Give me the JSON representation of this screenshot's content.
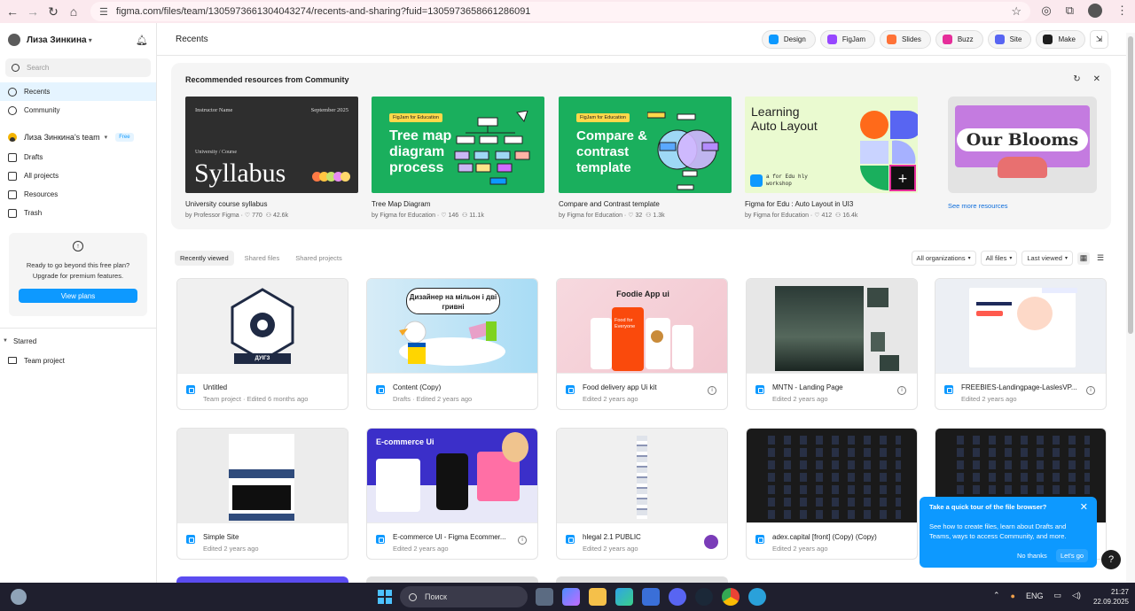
{
  "browser": {
    "url": "figma.com/files/team/1305973661304043274/recents-and-sharing?fuid=1305973658661286091"
  },
  "sidebar": {
    "user_name": "Лиза Зинкина",
    "search_placeholder": "Search",
    "nav": [
      {
        "label": "Recents",
        "icon": "clock-icon"
      },
      {
        "label": "Community",
        "icon": "globe-icon"
      }
    ],
    "team_name": "Лиза Зинкина's team",
    "team_badge": "Free",
    "team_nav": [
      {
        "label": "Drafts",
        "icon": "file-icon"
      },
      {
        "label": "All projects",
        "icon": "grid-icon"
      },
      {
        "label": "Resources",
        "icon": "resources-icon"
      },
      {
        "label": "Trash",
        "icon": "trash-icon"
      }
    ],
    "upgrade_text_1": "Ready to go beyond this free plan?",
    "upgrade_text_2": "Upgrade for premium features.",
    "upgrade_button": "View plans",
    "starred_label": "Starred",
    "starred_items": [
      "Team project"
    ]
  },
  "header": {
    "title": "Recents",
    "products": [
      {
        "label": "Design",
        "color": "#0d99ff"
      },
      {
        "label": "FigJam",
        "color": "#9747ff"
      },
      {
        "label": "Slides",
        "color": "#ff7237"
      },
      {
        "label": "Buzz",
        "color": "#e62e9a"
      },
      {
        "label": "Site",
        "color": "#5865f2"
      },
      {
        "label": "Make",
        "color": "#1e1e1e"
      }
    ]
  },
  "community": {
    "title": "Recommended resources from Community",
    "see_more": "See more resources",
    "cards": [
      {
        "title": "University course syllabus",
        "author": "by Professor Figma",
        "likes": "770",
        "users": "42.6k",
        "thumb": {
          "top_left": "Instructor Name",
          "top_right": "September 2025",
          "sub": "University / Course",
          "big": "Syllabus"
        }
      },
      {
        "title": "Tree Map Diagram",
        "author": "by Figma for Education",
        "likes": "146",
        "users": "11.1k",
        "thumb": {
          "tag": "FigJam for Education",
          "text": "Tree map diagram process"
        }
      },
      {
        "title": "Compare and Contrast template",
        "author": "by Figma for Education",
        "likes": "32",
        "users": "1.3k",
        "thumb": {
          "tag": "FigJam for Education",
          "text": "Compare & contrast template"
        }
      },
      {
        "title": "Figma for Edu : Auto Layout in UI3",
        "author": "by Figma for Education",
        "likes": "412",
        "users": "16.4k",
        "thumb": {
          "text": "Learning Auto Layout",
          "sub": "a for Edu hly workshop"
        }
      }
    ],
    "extra_thumb_text": "Our Blooms"
  },
  "tabs": [
    {
      "label": "Recently viewed",
      "active": true
    },
    {
      "label": "Shared files",
      "active": false
    },
    {
      "label": "Shared projects",
      "active": false
    }
  ],
  "filters": [
    "All organizations",
    "All files",
    "Last viewed"
  ],
  "files": [
    {
      "name": "Untitled",
      "meta": "Team project · Edited 6 months ago",
      "thumb_text": "ДУІГЗ"
    },
    {
      "name": "Content (Copy)",
      "meta": "Drafts · Edited 2 years ago",
      "thumb_text": "Дизайнер на мільон і дві гривні"
    },
    {
      "name": "Food delivery app Ui kit",
      "meta": "Edited 2 years ago",
      "thumb_text": "Foodie App ui",
      "thumb_sub": "Food for Everyone"
    },
    {
      "name": "MNTN - Landing Page",
      "meta": "Edited 2 years ago"
    },
    {
      "name": "FREEBIES-Landingpage-LaslesVP...",
      "meta": "Edited 2 years ago"
    },
    {
      "name": "Simple Site",
      "meta": "Edited 2 years ago"
    },
    {
      "name": "E-commerce UI - Figma Ecommer...",
      "meta": "Edited 2 years ago",
      "thumb_text": "E-commerce Ui"
    },
    {
      "name": "hlegal 2.1 PUBLIC",
      "meta": "Edited 2 years ago"
    },
    {
      "name": "adex.capital [front] (Copy) (Copy)",
      "meta": "Edited 2 years ago"
    },
    {
      "name": "",
      "meta": ""
    }
  ],
  "tour": {
    "title": "Take a quick tour of the file browser?",
    "body": "See how to create files, learn about Drafts and Teams, ways to access Community, and more.",
    "no_thanks": "No thanks",
    "lets_go": "Let's go"
  },
  "help_label": "?",
  "taskbar": {
    "search_label": "Поиск",
    "language": "ENG",
    "time": "21:27",
    "date": "22.09.2025"
  }
}
